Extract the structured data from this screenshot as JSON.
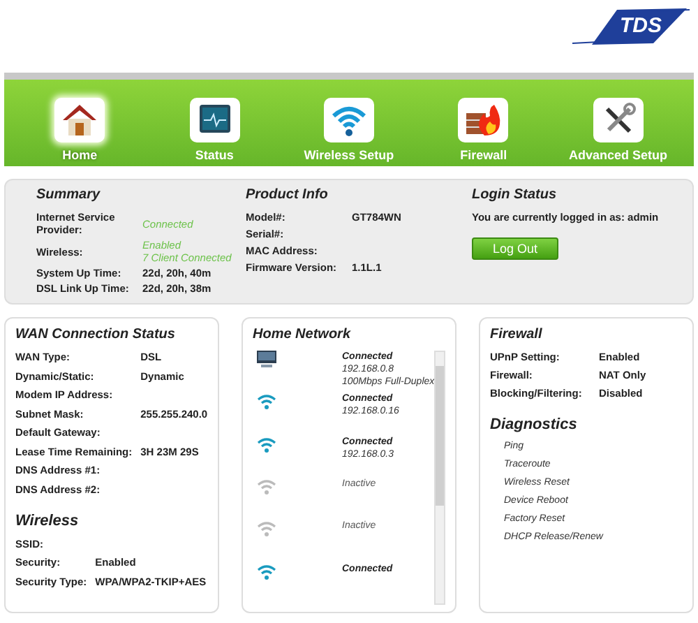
{
  "logo": {
    "text": "TDS"
  },
  "nav": [
    {
      "label": "Home",
      "selected": true
    },
    {
      "label": "Status",
      "selected": false
    },
    {
      "label": "Wireless Setup",
      "selected": false
    },
    {
      "label": "Firewall",
      "selected": false
    },
    {
      "label": "Advanced Setup",
      "selected": false
    }
  ],
  "summary": {
    "title": "Summary",
    "rows": [
      {
        "label": "Internet Service Provider:",
        "value": "Connected",
        "status": true
      },
      {
        "label": "Wireless:",
        "value": "Enabled",
        "detail": "7 Client Connected",
        "status": true
      },
      {
        "label": "System Up Time:",
        "value": "22d, 20h, 40m",
        "status": false
      },
      {
        "label": "DSL Link Up Time:",
        "value": "22d, 20h, 38m",
        "status": false
      }
    ]
  },
  "product_info": {
    "title": "Product Info",
    "rows": [
      {
        "label": "Model#:",
        "value": "GT784WN"
      },
      {
        "label": "Serial#:"
      },
      {
        "label": "MAC Address:"
      },
      {
        "label": "Firmware Version:",
        "value": "1.1L.1"
      }
    ]
  },
  "login_status": {
    "title": "Login Status",
    "message": "You are currently logged in as: admin",
    "button": "Log Out"
  },
  "wan": {
    "title": "WAN Connection Status",
    "rows": [
      {
        "label": "WAN Type:",
        "value": "DSL"
      },
      {
        "label": "Dynamic/Static:",
        "value": "Dynamic"
      },
      {
        "label": "Modem IP Address:"
      },
      {
        "label": "Subnet Mask:",
        "value": "255.255.240.0"
      },
      {
        "label": "Default Gateway:"
      },
      {
        "label": "Lease Time Remaining:",
        "value": "3H 23M 29S"
      },
      {
        "label": "DNS Address #1:"
      },
      {
        "label": "DNS Address #2:"
      }
    ]
  },
  "wireless": {
    "title": "Wireless",
    "rows": [
      {
        "label": "SSID:"
      },
      {
        "label": "Security:",
        "value": "Enabled"
      },
      {
        "label": "Security Type:",
        "value": "WPA/WPA2-TKIP+AES"
      }
    ]
  },
  "home_network": {
    "title": "Home Network",
    "devices": [
      {
        "kind": "wired",
        "active": true,
        "status": "Connected",
        "lines": [
          "192.168.0.8",
          "100Mbps Full-Duplex"
        ]
      },
      {
        "kind": "wireless",
        "active": true,
        "status": "Connected",
        "lines": [
          "192.168.0.16"
        ]
      },
      {
        "kind": "wireless",
        "active": true,
        "status": "Connected",
        "lines": [
          "192.168.0.3"
        ]
      },
      {
        "kind": "wireless",
        "active": false,
        "status": "Inactive"
      },
      {
        "kind": "wireless",
        "active": false,
        "status": "Inactive"
      },
      {
        "kind": "wireless",
        "active": true,
        "status": "Connected"
      }
    ]
  },
  "firewall": {
    "title": "Firewall",
    "rows": [
      {
        "label": "UPnP Setting:",
        "value": "Enabled"
      },
      {
        "label": "Firewall:",
        "value": "NAT Only"
      },
      {
        "label": "Blocking/Filtering:",
        "value": "Disabled"
      }
    ]
  },
  "diagnostics": {
    "title": "Diagnostics",
    "links": [
      "Ping",
      "Traceroute",
      "Wireless Reset",
      "Device Reboot",
      "Factory Reset",
      "DHCP Release/Renew"
    ]
  }
}
